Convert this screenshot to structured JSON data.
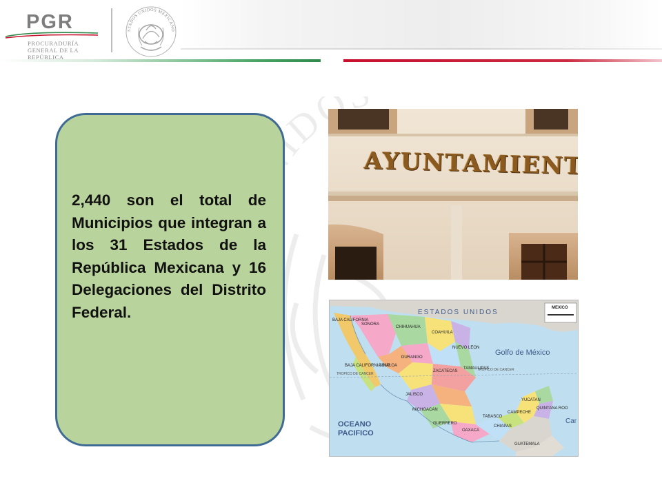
{
  "header": {
    "logo_text": "PGR",
    "logo_subtitle": "PROCURADURÍA GENERAL DE LA REPÚBLICA",
    "seal_text": "ESTADOS UNIDOS MEXICANOS",
    "colors": {
      "green": "#2f8a4b",
      "red": "#c8102e",
      "gray": "#7d7d7d"
    }
  },
  "slide": {
    "body_text": "2,440 son el total de Municipios que integran a los 31 Estados de la República Mexicana y 16 Delegaciones del Distrito Federal.",
    "box_colors": {
      "fill": "#b9d39c",
      "border": "#3e6a93"
    },
    "watermark_text": "UNIDOS"
  },
  "photo": {
    "sign_text": "AYUNTAMIENTO"
  },
  "map": {
    "country_label": "ESTADOS UNIDOS",
    "gulf_label": "Golfo de México",
    "ocean_label": "OCEANO PACIFICO",
    "caribbean_label": "Car",
    "tropic_label": "TROPICO DE CANCER",
    "legend_title": "MEXICO",
    "states": [
      "SONORA",
      "CHIHUAHUA",
      "COAHUILA",
      "BAJA CALIFORNIA",
      "BAJA CALIFORNIA SUR",
      "SINALOA",
      "DURANGO",
      "ZACATECAS",
      "NUEVO LEON",
      "TAMAULIPAS",
      "JALISCO",
      "MICHOACAN",
      "GUERRERO",
      "OAXACA",
      "CHIAPAS",
      "YUCATAN",
      "QUINTANA ROO",
      "CAMPECHE",
      "TABASCO",
      "GUATEMALA"
    ]
  }
}
